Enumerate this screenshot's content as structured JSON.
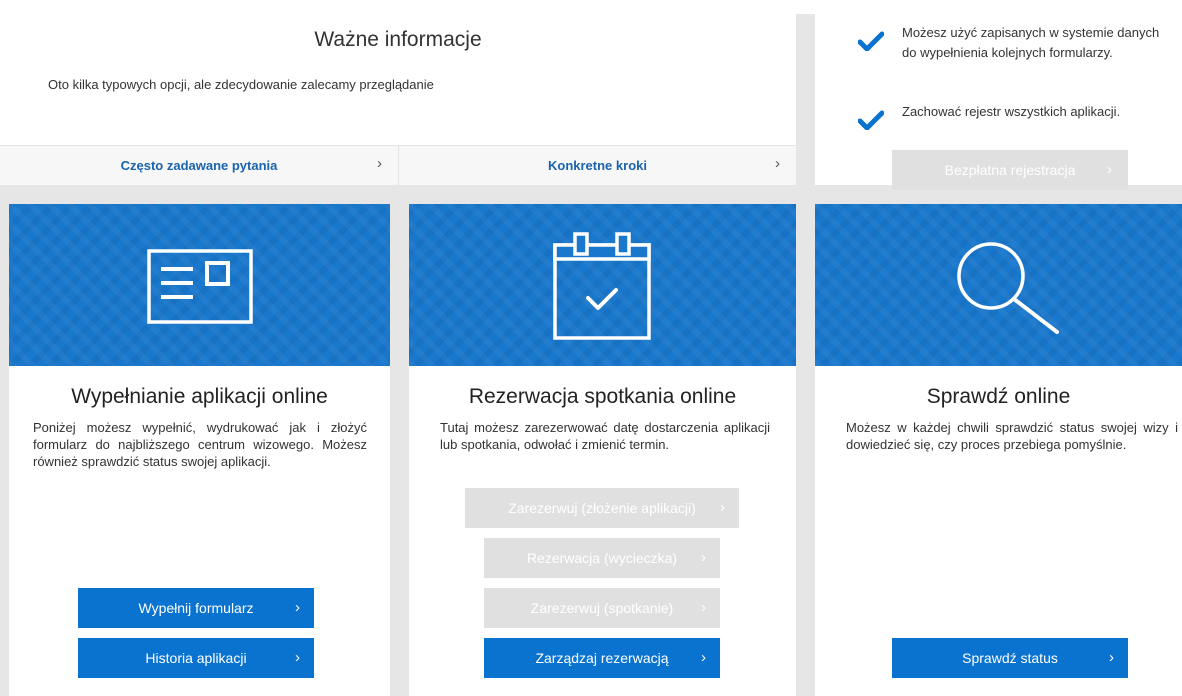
{
  "info": {
    "title": "Ważne informacje",
    "subtitle": "Oto kilka typowych opcji, ale zdecydowanie zalecamy przeglądanie",
    "links": [
      {
        "label": "Często zadawane pytania",
        "chevron": "›"
      },
      {
        "label": "Konkretne kroki",
        "chevron": "›"
      }
    ]
  },
  "benefits": {
    "items": [
      {
        "text": "Możesz użyć zapisanych w systemie danych do wypełnienia kolejnych formularzy.",
        "icon": "check-icon"
      },
      {
        "text": "Zachować rejestr wszystkich aplikacji.",
        "icon": "check-icon"
      }
    ],
    "register_button": {
      "label": "Bezpłatna rejestracja",
      "chevron": "›"
    }
  },
  "cards": [
    {
      "icon": "form-card-icon",
      "title": "Wypełnianie aplikacji online",
      "description": "Poniżej możesz wypełnić, wydrukować jak i złożyć formularz do najbliższego centrum wizowego. Możesz również sprawdzić status swojej aplikacji.",
      "buttons": [
        {
          "label": "Wypełnij formularz",
          "chevron": "›",
          "enabled": true
        },
        {
          "label": "Historia aplikacji",
          "chevron": "›",
          "enabled": true
        }
      ]
    },
    {
      "icon": "calendar-check-icon",
      "title": "Rezerwacja spotkania online",
      "description": "Tutaj możesz zarezerwować datę dostarczenia aplikacji lub spotkania, odwołać i zmienić termin.",
      "buttons": [
        {
          "label": "Zarezerwuj (złożenie aplikacji)",
          "chevron": "›",
          "enabled": false
        },
        {
          "label": "Rezerwacja (wycieczka)",
          "chevron": "›",
          "enabled": false
        },
        {
          "label": "Zarezerwuj (spotkanie)",
          "chevron": "›",
          "enabled": false
        },
        {
          "label": "Zarządzaj rezerwacją",
          "chevron": "›",
          "enabled": true
        }
      ]
    },
    {
      "icon": "search-icon",
      "title": "Sprawdź online",
      "description": "Możesz w każdej chwili sprawdzić status swojej wizy i dowiedzieć się, czy proces przebiega pomyślnie.",
      "buttons": [
        {
          "label": "Sprawdź status",
          "chevron": "›",
          "enabled": true
        }
      ]
    }
  ],
  "colors": {
    "accent_blue": "#0a73cf",
    "banner_blue": "#1977cc",
    "link_blue": "#1a63ad",
    "disabled_grey": "#e0e0e0",
    "gutter_grey": "#e6e6e6"
  }
}
